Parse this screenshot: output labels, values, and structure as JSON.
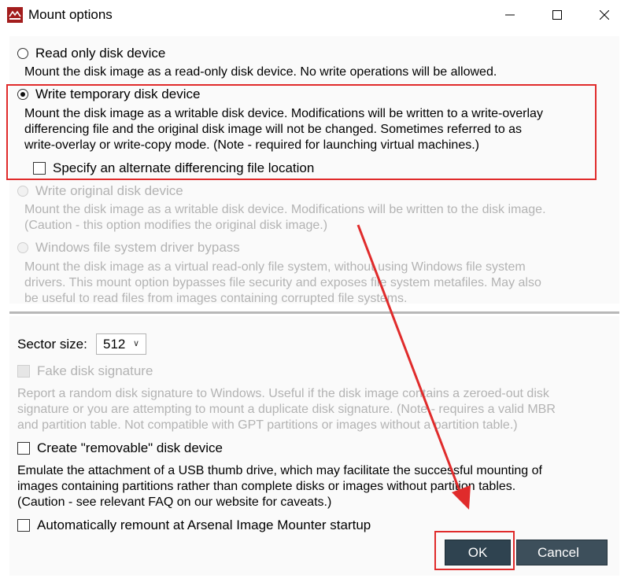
{
  "window": {
    "title": "Mount options"
  },
  "options": {
    "read_only": {
      "label": "Read only disk device",
      "description": "Mount the disk image as a read-only disk device. No write operations will be allowed."
    },
    "write_temporary": {
      "label": "Write temporary disk device",
      "description_lines": [
        "Mount the disk image as a writable disk device. Modifications will be written to a write-overlay",
        "differencing file and the original disk image will not be changed. Sometimes referred to as",
        "write-overlay or write-copy mode. (Note - required for launching virtual machines.)"
      ],
      "alternate_location_label": "Specify an alternate differencing file location"
    },
    "write_original": {
      "label": "Write original disk device",
      "description_lines": [
        "Mount the disk image as a writable disk device. Modifications will be written to the disk image.",
        "(Caution - this option modifies the original disk image.)"
      ]
    },
    "fs_bypass": {
      "label": "Windows file system driver bypass",
      "description_lines": [
        "Mount the disk image as a virtual read-only file system, without using Windows file system",
        "drivers. This mount option bypasses file security and exposes file system metafiles. May also",
        "be useful to read files from images containing corrupted file systems."
      ]
    }
  },
  "sector": {
    "label": "Sector size:",
    "value": "512"
  },
  "fake_signature": {
    "label": "Fake disk signature",
    "description_lines": [
      "Report a random disk signature to Windows. Useful if the disk image contains a zeroed-out disk",
      "signature or you are attempting to mount a duplicate disk signature. (Note - requires a valid MBR",
      "and partition table. Not compatible with GPT partitions or images without a partition table.)"
    ]
  },
  "removable": {
    "label": "Create \"removable\" disk device",
    "description_lines": [
      "Emulate the attachment of a USB thumb drive, which may facilitate the successful mounting of",
      "images containing partitions rather than complete disks or images without partition tables.",
      "(Caution - see relevant FAQ on our website for caveats.)"
    ]
  },
  "auto_remount": {
    "label": "Automatically remount at Arsenal Image Mounter startup"
  },
  "buttons": {
    "ok": "OK",
    "cancel": "Cancel"
  },
  "colors": {
    "highlight": "#e02b2b",
    "button_bg": "#2f4350",
    "disabled_text": "#b3b3b3"
  }
}
